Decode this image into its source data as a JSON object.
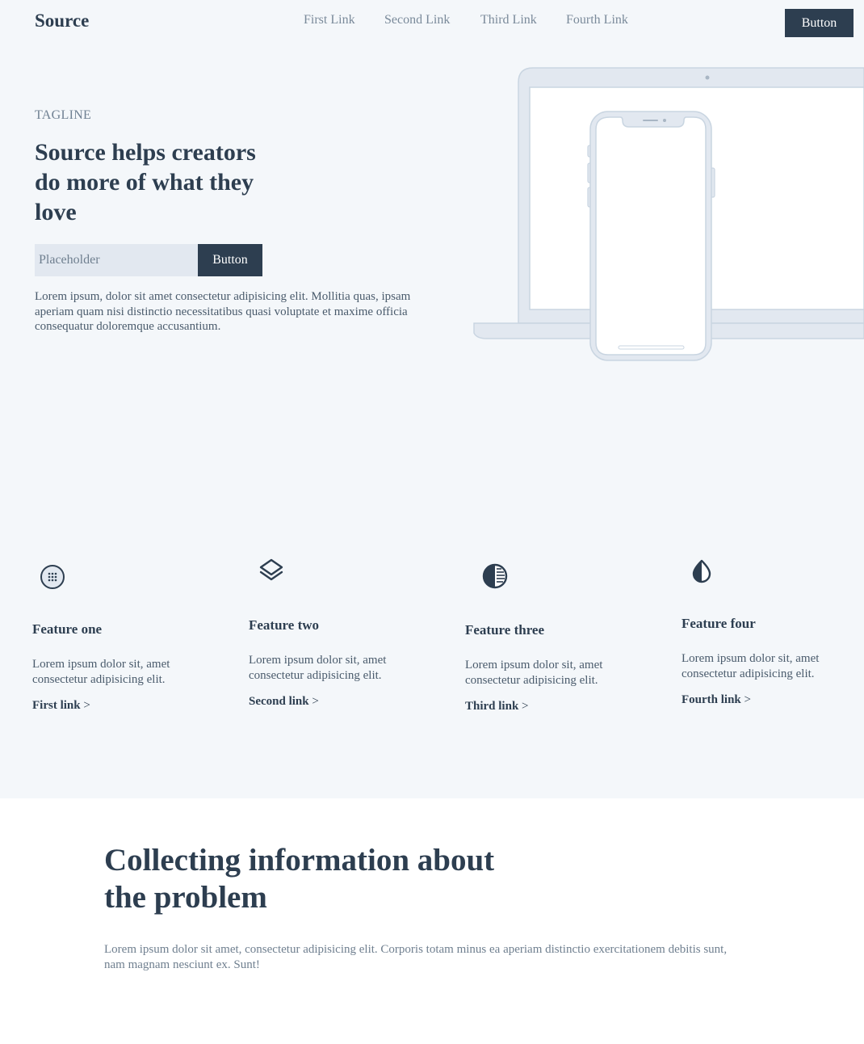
{
  "header": {
    "brand": "Source",
    "nav": [
      "First Link",
      "Second Link",
      "Third Link",
      "Fourth Link"
    ],
    "button_label": "Button"
  },
  "hero": {
    "tagline": "TAGLINE",
    "title": "Source helps creators do more of what they love",
    "input_placeholder": "Placeholder",
    "button_label": "Button",
    "text": "Lorem ipsum, dolor sit amet consectetur adipisicing elit. Mollitia quas, ipsam aperiam quam nisi distinctio necessitatibus quasi voluptate et maxime officia consequatur doloremque accusantium."
  },
  "features": [
    {
      "icon": "grid-circle-icon",
      "title": "Feature one",
      "text": "Lorem ipsum dolor sit, amet consectetur adipisicing elit.",
      "link": "First link",
      "arrow": ">"
    },
    {
      "icon": "layers-icon",
      "title": "Feature two",
      "text": "Lorem ipsum dolor sit, amet consectetur adipisicing elit.",
      "link": "Second link",
      "arrow": ">"
    },
    {
      "icon": "contrast-icon",
      "title": "Feature three",
      "text": "Lorem ipsum dolor sit, amet consectetur adipisicing elit.",
      "link": "Third link",
      "arrow": ">"
    },
    {
      "icon": "droplet-icon",
      "title": "Feature four",
      "text": "Lorem ipsum dolor sit, amet consectetur adipisicing elit.",
      "link": "Fourth link",
      "arrow": ">"
    }
  ],
  "section": {
    "title": "Collecting information about the problem",
    "text": "Lorem ipsum dolor sit amet, consectetur adipisicing elit. Corporis totam minus ea aperiam distinctio exercitationem debitis sunt, nam magnam nesciunt ex. Sunt!"
  },
  "colors": {
    "primary": "#2d3e50",
    "background": "#f4f7fa",
    "muted": "#7a8a9a",
    "device_outline": "#c9d5e1",
    "device_fill": "#e2e8f0"
  }
}
